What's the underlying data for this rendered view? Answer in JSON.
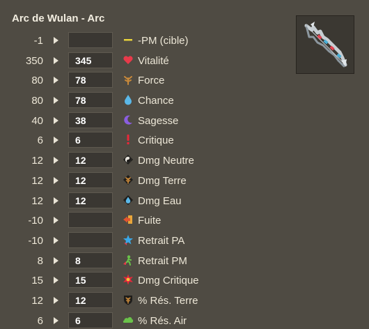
{
  "header": {
    "title": "Arc de Wulan - Arc",
    "item_image": "bow-item-icon"
  },
  "stats": [
    {
      "base": "-1",
      "value": "",
      "label": "-PM (cible)",
      "icon": "mp-dash-icon"
    },
    {
      "base": "350",
      "value": "345",
      "label": "Vitalité",
      "icon": "heart-icon"
    },
    {
      "base": "80",
      "value": "78",
      "label": "Force",
      "icon": "earth-icon"
    },
    {
      "base": "80",
      "value": "78",
      "label": "Chance",
      "icon": "water-drop-icon"
    },
    {
      "base": "40",
      "value": "38",
      "label": "Sagesse",
      "icon": "moon-icon"
    },
    {
      "base": "6",
      "value": "6",
      "label": "Critique",
      "icon": "exclamation-icon"
    },
    {
      "base": "12",
      "value": "12",
      "label": "Dmg Neutre",
      "icon": "neutral-yin-icon"
    },
    {
      "base": "12",
      "value": "12",
      "label": "Dmg Terre",
      "icon": "earth-damage-icon"
    },
    {
      "base": "12",
      "value": "12",
      "label": "Dmg Eau",
      "icon": "water-damage-icon"
    },
    {
      "base": "-10",
      "value": "",
      "label": "Fuite",
      "icon": "flee-icon"
    },
    {
      "base": "-10",
      "value": "",
      "label": "Retrait PA",
      "icon": "ap-reduction-icon"
    },
    {
      "base": "8",
      "value": "8",
      "label": "Retrait PM",
      "icon": "mp-reduction-icon"
    },
    {
      "base": "15",
      "value": "15",
      "label": "Dmg Critique",
      "icon": "critical-damage-icon"
    },
    {
      "base": "12",
      "value": "12",
      "label": "% Rés. Terre",
      "icon": "earth-resistance-icon"
    },
    {
      "base": "6",
      "value": "6",
      "label": "% Rés. Air",
      "icon": "air-resistance-icon"
    }
  ],
  "colors": {
    "panel_bg": "#4f4b43",
    "input_bg": "#3a3732",
    "text": "#ece6d6"
  }
}
